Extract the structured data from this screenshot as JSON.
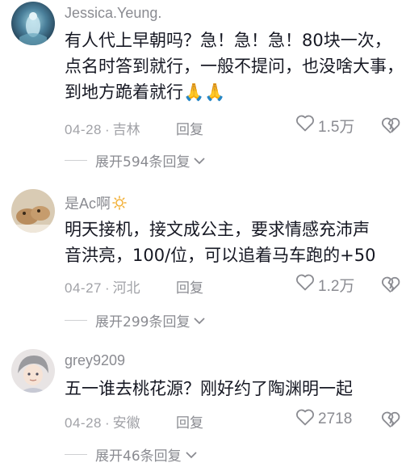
{
  "comments": [
    {
      "username": "Jessica.Yeung.",
      "text_lines": [
        "有人代上早朝吗？急！急！急！80块一次，",
        "点名时答到就行，一般不提问，也没啥大事，",
        "到地方跪着就行🙏🙏"
      ],
      "date": "04-28",
      "location": "吉林",
      "reply_label": "回复",
      "likes": "1.5万",
      "expand_label": "展开594条回复"
    },
    {
      "username": "是Ac啊",
      "text_lines": [
        "明天接机，接文成公主，要求情感充沛声",
        "音洪亮，100/位，可以追着马车跑的+50"
      ],
      "date": "04-27",
      "location": "河北",
      "reply_label": "回复",
      "likes": "1.2万",
      "expand_label": "展开299条回复"
    },
    {
      "username": "grey9209",
      "text_lines": [
        "五一谁去桃花源？刚好约了陶渊明一起"
      ],
      "date": "04-28",
      "location": "安徽",
      "reply_label": "回复",
      "likes": "2718",
      "expand_label": "展开46条回复"
    }
  ],
  "icons": {
    "like": "heart-outline-icon",
    "dislike": "broken-heart-icon",
    "expand": "chevron-down-icon",
    "username_badge": "sun-icon"
  },
  "colors": {
    "text": "#161823",
    "secondary": "#8a8b91",
    "meta": "#a1a2a7"
  }
}
